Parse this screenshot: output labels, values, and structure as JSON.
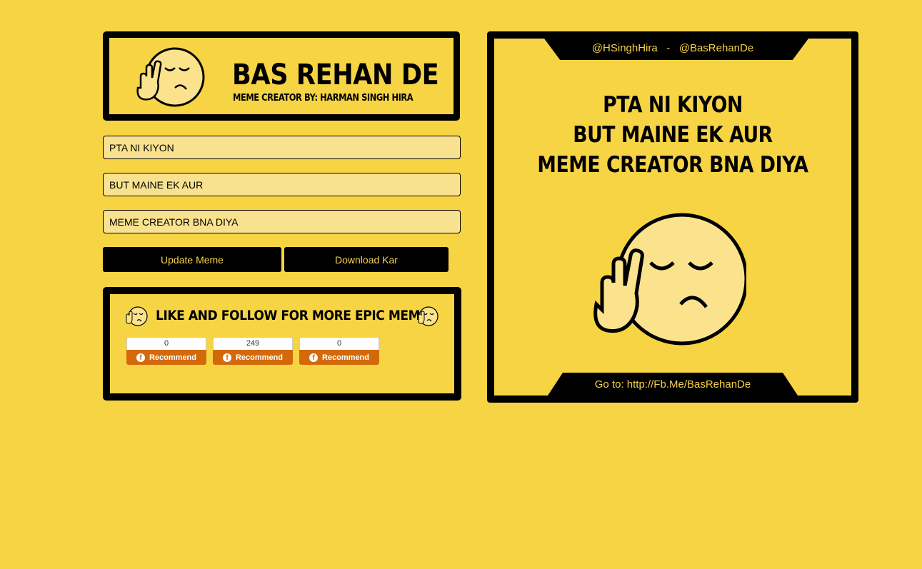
{
  "header": {
    "title": "BAS REHAN DE",
    "subtitle": "MEME CREATOR BY: HARMAN SINGH HIRA"
  },
  "inputs": {
    "line1": "PTA NI KIYON",
    "line2": "BUT MAINE EK AUR",
    "line3": "MEME CREATOR BNA DIYA"
  },
  "buttons": {
    "update": "Update Meme",
    "download": "Download Kar"
  },
  "social": {
    "heading": "LIKE AND FOLLOW FOR MORE EPIC MEMES",
    "widgets": [
      {
        "count": "0",
        "label": "Recommend"
      },
      {
        "count": "249",
        "label": "Recommend"
      },
      {
        "count": "0",
        "label": "Recommend"
      }
    ]
  },
  "meme": {
    "handles": "@HSinghHira   -   @BasRehanDe",
    "line1": "PTA NI KIYON",
    "line2": "BUT MAINE EK AUR",
    "line3": "MEME CREATOR BNA DIYA",
    "link": "Go to: http://Fb.Me/BasRehanDe"
  },
  "colors": {
    "background": "#f7d443",
    "face": "#fbe38e",
    "frame": "#000000",
    "button_text": "#f5d04a",
    "recommend": "#d4690c"
  }
}
